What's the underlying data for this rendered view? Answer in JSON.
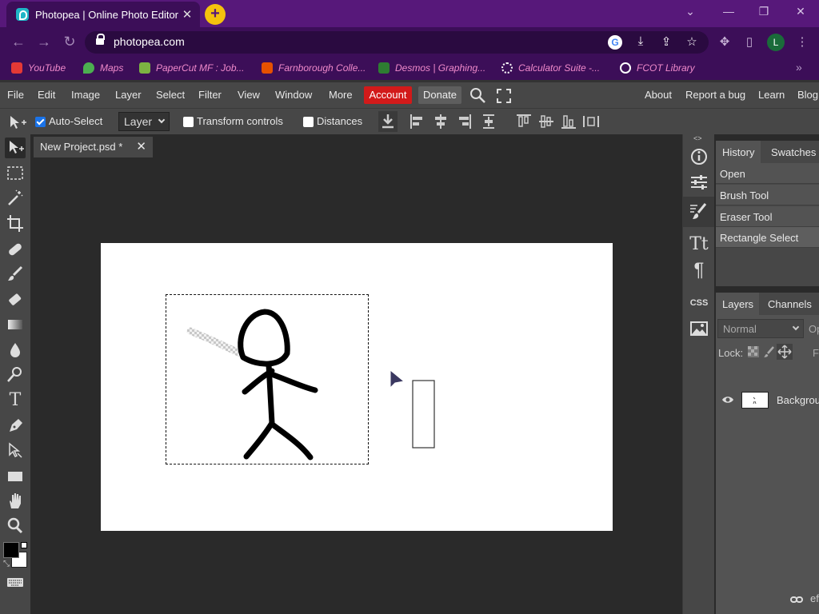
{
  "browser": {
    "tab_title": "Photopea | Online Photo Editor",
    "tab_close": "✕",
    "new_tab": "+",
    "url": "photopea.com",
    "profile_initial": "L",
    "bookmarks": [
      {
        "label": "YouTube",
        "color": "#e53935"
      },
      {
        "label": "Maps",
        "color": "#4caf50"
      },
      {
        "label": "PaperCut MF : Job...",
        "color": "#7cb342"
      },
      {
        "label": "Farnborough Colle...",
        "color": "#e65100"
      },
      {
        "label": "Desmos | Graphing...",
        "color": "#2e7d32"
      },
      {
        "label": "Calculator Suite -...",
        "color": "#ffffff"
      },
      {
        "label": "FCOT Library",
        "color": "#ffffff"
      }
    ],
    "bookmarks_more": "»"
  },
  "menu": {
    "items": [
      "File",
      "Edit",
      "Image",
      "Layer",
      "Select",
      "Filter",
      "View",
      "Window",
      "More"
    ],
    "account": "Account",
    "donate": "Donate",
    "right_items": [
      "About",
      "Report a bug",
      "Learn",
      "Blog"
    ]
  },
  "options": {
    "auto_select_label": "Auto-Select",
    "auto_select_checked": true,
    "layer_select_value": "Layer",
    "transform_controls_label": "Transform controls",
    "distances_label": "Distances"
  },
  "document": {
    "tab_title": "New Project.psd *",
    "close": "✕"
  },
  "history": {
    "tabs": [
      "History",
      "Swatches"
    ],
    "items": [
      "Open",
      "Brush Tool",
      "Eraser Tool",
      "Rectangle Select"
    ]
  },
  "layers": {
    "tabs": [
      "Layers",
      "Channels"
    ],
    "blend_mode": "Normal",
    "opacity_label": "Op",
    "lock_label": "Lock:",
    "fill_label": "F",
    "layer_name": "Backgrou",
    "footer_text": "ef"
  },
  "colors": {
    "tab_bar": "#57187a",
    "toolbar": "#3c0e58",
    "account_button": "#d21a1a",
    "panel_bg": "#474747",
    "workspace": "#2a2a2a"
  }
}
